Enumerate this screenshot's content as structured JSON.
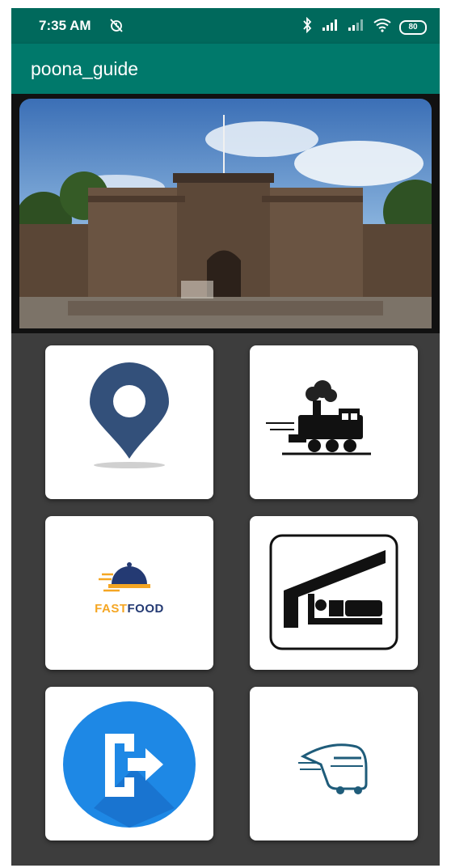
{
  "status_bar": {
    "time": "7:35 AM",
    "battery": "80",
    "icons": [
      "alarm-off-icon",
      "bluetooth-icon",
      "signal-icon",
      "signal-icon",
      "wifi-icon",
      "battery-icon"
    ]
  },
  "app_bar": {
    "title": "poona_guide",
    "color": "#00796b",
    "status_color": "#00695c"
  },
  "banner": {
    "image": "shaniwar-wada-fort-photo"
  },
  "menu": {
    "background": "#3d3d3d",
    "tiles": [
      {
        "icon": "location-pin-icon"
      },
      {
        "icon": "train-icon"
      },
      {
        "icon": "fast-food-logo",
        "text_part1": "FAST",
        "text_part2": "FOOD"
      },
      {
        "icon": "hotel-bed-icon"
      },
      {
        "icon": "exit-icon"
      },
      {
        "icon": "bus-icon"
      }
    ]
  }
}
